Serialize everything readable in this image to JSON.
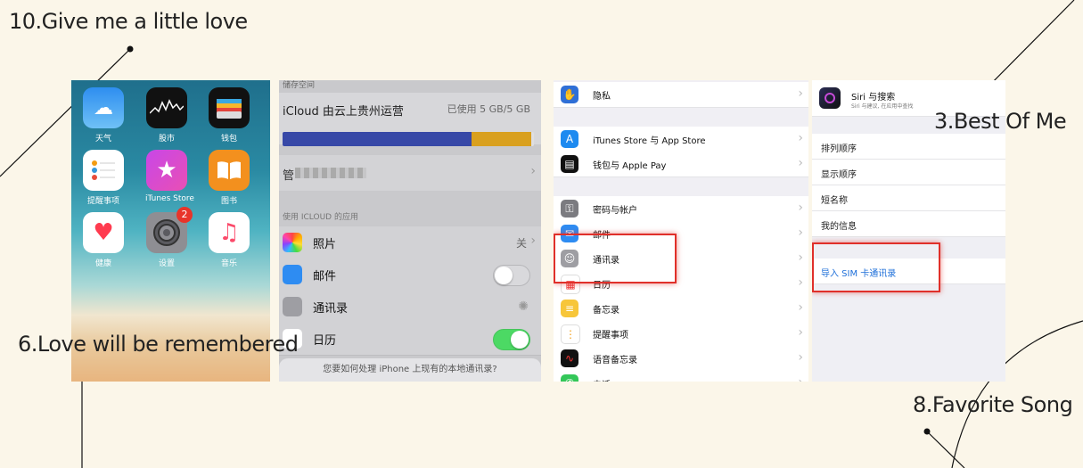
{
  "captions": {
    "top_left": "10.Give me a little love",
    "middle_left": "6.Love will be remembered",
    "right_top": "3.Best Of Me",
    "right_bottom": "8.Favorite Song"
  },
  "home_screen": {
    "apps": [
      {
        "label": "天气",
        "icon": "weather-icon"
      },
      {
        "label": "股市",
        "icon": "stocks-icon"
      },
      {
        "label": "钱包",
        "icon": "wallet-icon"
      },
      {
        "label": "提醒事项",
        "icon": "reminders-icon"
      },
      {
        "label": "iTunes Store",
        "icon": "itunes-star-icon"
      },
      {
        "label": "图书",
        "icon": "books-icon"
      },
      {
        "label": "健康",
        "icon": "health-heart-icon"
      },
      {
        "label": "设置",
        "icon": "settings-gear-icon",
        "badge": "2"
      },
      {
        "label": "音乐",
        "icon": "music-note-icon"
      }
    ]
  },
  "icloud_panel": {
    "section_top": "储存空间",
    "title": "iCloud 由云上贵州运营",
    "usage": "已使用 5 GB/5 GB",
    "storage_fraction_blue": 0.75,
    "storage_fraction_yellow": 0.24,
    "manage_label": "管",
    "apps_section": "使用 ICLOUD 的应用",
    "rows": [
      {
        "label": "照片",
        "value": "关"
      },
      {
        "label": "邮件"
      },
      {
        "label": "通讯录"
      },
      {
        "label": "日历"
      }
    ],
    "dialog": "您要如何处理 iPhone 上现有的本地通讯录?"
  },
  "settings_panel": {
    "rows": [
      {
        "label": "隐私",
        "icon": "privacy-hand-icon",
        "color": "#2f6fd6"
      },
      {
        "label": "iTunes Store 与 App Store",
        "icon": "app-store-icon",
        "color": "#1d8af0"
      },
      {
        "label": "钱包与 Apple Pay",
        "icon": "wallet-icon",
        "color": "#111111"
      },
      {
        "label": "密码与帐户",
        "icon": "key-icon",
        "color": "#7b7b80"
      },
      {
        "label": "邮件",
        "icon": "mail-icon",
        "color": "#2e8cf2"
      },
      {
        "label": "通讯录",
        "icon": "contacts-icon",
        "color": "#9e9ea3"
      },
      {
        "label": "日历",
        "icon": "calendar-icon",
        "color": "#ffffff"
      },
      {
        "label": "备忘录",
        "icon": "notes-icon",
        "color": "#f7c63a"
      },
      {
        "label": "提醒事项",
        "icon": "reminders-icon",
        "color": "#ffffff"
      },
      {
        "label": "语音备忘录",
        "icon": "voice-memos-icon",
        "color": "#111111"
      },
      {
        "label": "电话",
        "icon": "phone-icon",
        "color": "#34c759"
      }
    ]
  },
  "contacts_panel": {
    "siri_title": "Siri 与搜索",
    "siri_sub": "Siri 与建议, 在应用中查找",
    "rows": [
      {
        "label": "排列顺序"
      },
      {
        "label": "显示顺序"
      },
      {
        "label": "短名称"
      },
      {
        "label": "我的信息"
      }
    ],
    "import_label": "导入 SIM 卡通讯录"
  },
  "colors": {
    "highlight": "#e0302a",
    "background": "#fbf6e9",
    "link_blue": "#1e6fd9"
  }
}
